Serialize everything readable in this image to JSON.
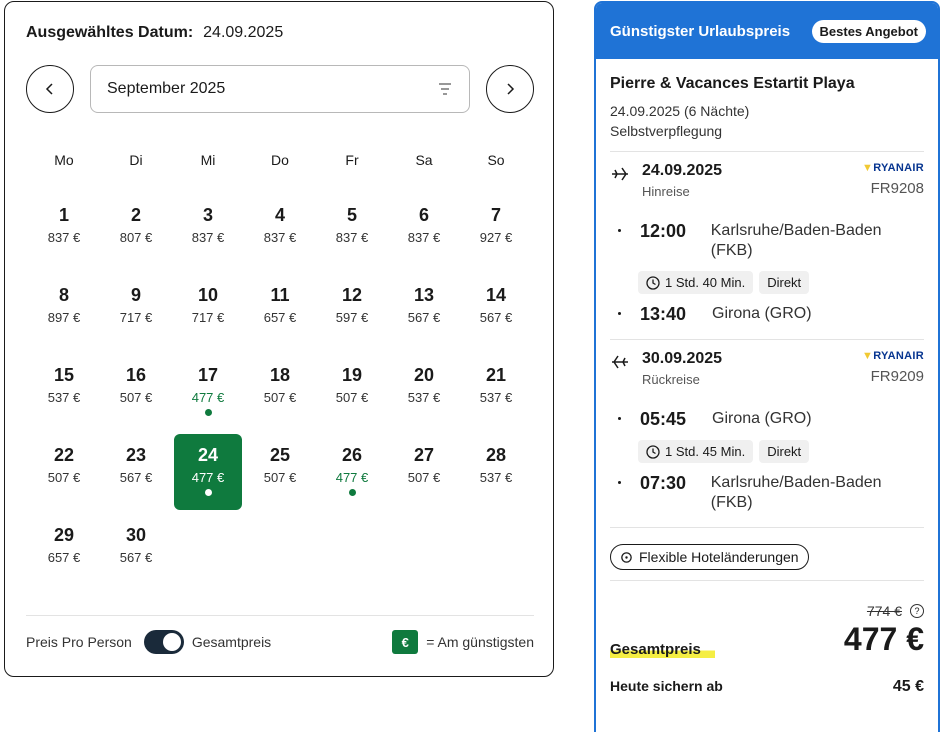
{
  "calendar": {
    "selected_label": "Ausgewähltes Datum:",
    "selected_date": "24.09.2025",
    "month": "September 2025",
    "weekdays": [
      "Mo",
      "Di",
      "Mi",
      "Do",
      "Fr",
      "Sa",
      "So"
    ],
    "days": [
      {
        "n": "1",
        "p": "837 €"
      },
      {
        "n": "2",
        "p": "807 €"
      },
      {
        "n": "3",
        "p": "837 €"
      },
      {
        "n": "4",
        "p": "837 €"
      },
      {
        "n": "5",
        "p": "837 €"
      },
      {
        "n": "6",
        "p": "837 €"
      },
      {
        "n": "7",
        "p": "927 €"
      },
      {
        "n": "8",
        "p": "897 €"
      },
      {
        "n": "9",
        "p": "717 €"
      },
      {
        "n": "10",
        "p": "717 €"
      },
      {
        "n": "11",
        "p": "657 €"
      },
      {
        "n": "12",
        "p": "597 €"
      },
      {
        "n": "13",
        "p": "567 €"
      },
      {
        "n": "14",
        "p": "567 €"
      },
      {
        "n": "15",
        "p": "537 €"
      },
      {
        "n": "16",
        "p": "507 €"
      },
      {
        "n": "17",
        "p": "477 €",
        "cheap": true
      },
      {
        "n": "18",
        "p": "507 €"
      },
      {
        "n": "19",
        "p": "507 €"
      },
      {
        "n": "20",
        "p": "537 €"
      },
      {
        "n": "21",
        "p": "537 €"
      },
      {
        "n": "22",
        "p": "507 €"
      },
      {
        "n": "23",
        "p": "567 €"
      },
      {
        "n": "24",
        "p": "477 €",
        "cheap": true,
        "selected": true
      },
      {
        "n": "25",
        "p": "507 €"
      },
      {
        "n": "26",
        "p": "477 €",
        "cheap": true
      },
      {
        "n": "27",
        "p": "507 €"
      },
      {
        "n": "28",
        "p": "537 €"
      },
      {
        "n": "29",
        "p": "657 €"
      },
      {
        "n": "30",
        "p": "567 €"
      }
    ],
    "footer": {
      "per_person": "Preis Pro Person",
      "total": "Gesamtpreis",
      "legend_symbol": "€",
      "legend_text": "= Am günstigsten"
    }
  },
  "offer": {
    "header": "Günstigster Urlaubspreis",
    "badge": "Bestes Angebot",
    "hotel": "Pierre & Vacances Estartit Playa",
    "dates": "24.09.2025 (6 Nächte)",
    "board": "Selbstverpflegung",
    "outbound": {
      "date": "24.09.2025",
      "direction": "Hinreise",
      "airline": "RYANAIR",
      "flight_no": "FR9208",
      "dep_time": "12:00",
      "dep_place": "Karlsruhe/Baden-Baden (FKB)",
      "duration": "1 Std. 40 Min.",
      "type": "Direkt",
      "arr_time": "13:40",
      "arr_place": "Girona (GRO)"
    },
    "inbound": {
      "date": "30.09.2025",
      "direction": "Rückreise",
      "airline": "RYANAIR",
      "flight_no": "FR9209",
      "dep_time": "05:45",
      "dep_place": "Girona (GRO)",
      "duration": "1 Std. 45 Min.",
      "type": "Direkt",
      "arr_time": "07:30",
      "arr_place": "Karlsruhe/Baden-Baden (FKB)"
    },
    "flex_label": "Flexible Hoteländerungen",
    "old_price": "774 €",
    "total_label": "Gesamtpreis",
    "total_price": "477 €",
    "today_label": "Heute sichern ab",
    "today_price": "45 €"
  },
  "colors": {
    "accent_green": "#0f7a3e",
    "accent_blue": "#1f73d6",
    "highlight": "#f5ee43"
  }
}
